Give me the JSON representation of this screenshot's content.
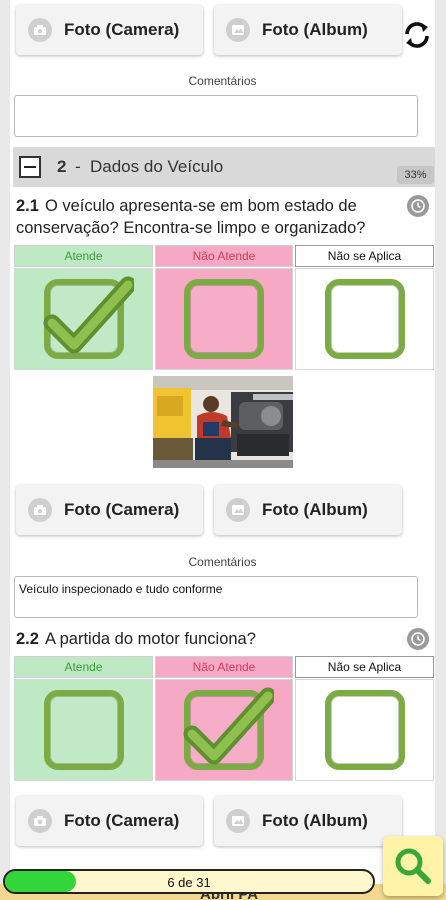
{
  "photo": {
    "camera_label": "Foto (Camera)",
    "album_label": "Foto (Album)"
  },
  "comments_label": "Comentários",
  "first_comment": "",
  "section": {
    "number": "2",
    "separator": "-",
    "title": "Dados do Veículo",
    "percent": "33%"
  },
  "questions": [
    {
      "number": "2.1",
      "text": "O veículo apresenta-se em bom estado de conservação? Encontra-se limpo e organizado?",
      "selected": "Atende",
      "comment": "Veículo inspecionado e tudo conforme"
    },
    {
      "number": "2.2",
      "text": "A partida do motor funciona?",
      "selected": "Não Atende"
    }
  ],
  "options": {
    "atende": "Atende",
    "nao_atende": "Não Atende",
    "nao_aplica": "Não se Aplica"
  },
  "colors": {
    "atende_bg": "#bfe8c4",
    "nao_atende_bg": "#f6a9c4",
    "check_green": "#7cab45",
    "progress_green": "#33d63a",
    "search_bg": "#fff3a8",
    "icon_green": "#3aa63a"
  },
  "progress": {
    "text": "6 de 31",
    "fraction": 0.194
  },
  "footer": {
    "partial_text": "Abril PA"
  }
}
